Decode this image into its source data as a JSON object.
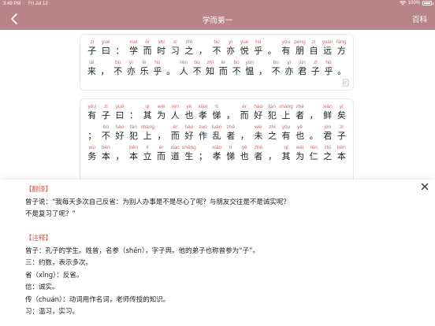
{
  "status": {
    "time": "3:49 PM",
    "date": "Fri Jul 12",
    "battery": "100%"
  },
  "nav": {
    "title": "学而第一",
    "right_label": "百科"
  },
  "passage1": [
    [
      {
        "py": "zǐ",
        "hz": "子"
      },
      {
        "py": "yuē",
        "hz": "曰"
      },
      {
        "py": "",
        "hz": "："
      },
      {
        "py": "xué",
        "hz": "学"
      },
      {
        "py": "ér",
        "hz": "而"
      },
      {
        "py": "shí",
        "hz": "时"
      },
      {
        "py": "xí",
        "hz": "习"
      },
      {
        "py": "zhī",
        "hz": "之"
      },
      {
        "py": "",
        "hz": "，"
      },
      {
        "py": "bù",
        "hz": "不"
      },
      {
        "py": "yì",
        "hz": "亦"
      },
      {
        "py": "yuè",
        "hz": "悦"
      },
      {
        "py": "hū",
        "hz": "乎"
      },
      {
        "py": "",
        "hz": "。"
      },
      {
        "py": "yǒu",
        "hz": "有"
      },
      {
        "py": "péng",
        "hz": "朋"
      },
      {
        "py": "zì",
        "hz": "自"
      },
      {
        "py": "yuǎn",
        "hz": "远"
      },
      {
        "py": "fāng",
        "hz": "方"
      }
    ],
    [
      {
        "py": "lái",
        "hz": "来"
      },
      {
        "py": "",
        "hz": "，"
      },
      {
        "py": "bú",
        "hz": "不"
      },
      {
        "py": "yì",
        "hz": "亦"
      },
      {
        "py": "lè",
        "hz": "乐"
      },
      {
        "py": "hū",
        "hz": "乎"
      },
      {
        "py": "",
        "hz": "。"
      },
      {
        "py": "rén",
        "hz": "人"
      },
      {
        "py": "bù",
        "hz": "不"
      },
      {
        "py": "zhī",
        "hz": "知"
      },
      {
        "py": "ér",
        "hz": "而"
      },
      {
        "py": "bú",
        "hz": "不"
      },
      {
        "py": "yùn",
        "hz": "愠"
      },
      {
        "py": "",
        "hz": "，"
      },
      {
        "py": "bú",
        "hz": "不"
      },
      {
        "py": "yì",
        "hz": "亦"
      },
      {
        "py": "jūn",
        "hz": "君"
      },
      {
        "py": "zǐ",
        "hz": "子"
      },
      {
        "py": "hū",
        "hz": "乎"
      },
      {
        "py": "",
        "hz": "。"
      }
    ]
  ],
  "passage2": [
    [
      {
        "py": "yǒu",
        "hz": "有"
      },
      {
        "py": "zǐ",
        "hz": "子"
      },
      {
        "py": "yuē",
        "hz": "曰"
      },
      {
        "py": "",
        "hz": "："
      },
      {
        "py": "qí",
        "hz": "其"
      },
      {
        "py": "wéi",
        "hz": "为"
      },
      {
        "py": "rén",
        "hz": "人"
      },
      {
        "py": "yě",
        "hz": "也"
      },
      {
        "py": "xiào",
        "hz": "孝"
      },
      {
        "py": "tì",
        "hz": "悌"
      },
      {
        "py": "",
        "hz": "，"
      },
      {
        "py": "ér",
        "hz": "而"
      },
      {
        "py": "hào",
        "hz": "好"
      },
      {
        "py": "fàn",
        "hz": "犯"
      },
      {
        "py": "shàng",
        "hz": "上"
      },
      {
        "py": "zhě",
        "hz": "者"
      },
      {
        "py": "",
        "hz": "，"
      },
      {
        "py": "xiǎn",
        "hz": "鲜"
      },
      {
        "py": "yǐ",
        "hz": "矣"
      }
    ],
    [
      {
        "py": "",
        "hz": "；"
      },
      {
        "py": "bù",
        "hz": "不"
      },
      {
        "py": "hào",
        "hz": "好"
      },
      {
        "py": "fàn",
        "hz": "犯"
      },
      {
        "py": "shàng",
        "hz": "上"
      },
      {
        "py": "",
        "hz": "，"
      },
      {
        "py": "ér",
        "hz": "而"
      },
      {
        "py": "hào",
        "hz": "好"
      },
      {
        "py": "zuò",
        "hz": "作"
      },
      {
        "py": "luàn",
        "hz": "乱"
      },
      {
        "py": "zhě",
        "hz": "者"
      },
      {
        "py": "",
        "hz": "，"
      },
      {
        "py": "wèi",
        "hz": "未"
      },
      {
        "py": "zhī",
        "hz": "之"
      },
      {
        "py": "yǒu",
        "hz": "有"
      },
      {
        "py": "yě",
        "hz": "也"
      },
      {
        "py": "",
        "hz": "。"
      },
      {
        "py": "jūn",
        "hz": "君"
      },
      {
        "py": "zǐ",
        "hz": "子"
      }
    ],
    [
      {
        "py": "wù",
        "hz": "务"
      },
      {
        "py": "běn",
        "hz": "本"
      },
      {
        "py": "",
        "hz": "，"
      },
      {
        "py": "běn",
        "hz": "本"
      },
      {
        "py": "lì",
        "hz": "立"
      },
      {
        "py": "ér",
        "hz": "而"
      },
      {
        "py": "dào",
        "hz": "道"
      },
      {
        "py": "shēng",
        "hz": "生"
      },
      {
        "py": "",
        "hz": "；"
      },
      {
        "py": "xiào",
        "hz": "孝"
      },
      {
        "py": "tì",
        "hz": "悌"
      },
      {
        "py": "yě",
        "hz": "也"
      },
      {
        "py": "zhě",
        "hz": "者"
      },
      {
        "py": "",
        "hz": "，"
      },
      {
        "py": "qí",
        "hz": "其"
      },
      {
        "py": "wéi",
        "hz": "为"
      },
      {
        "py": "rén",
        "hz": "仁"
      },
      {
        "py": "zhī",
        "hz": "之"
      },
      {
        "py": "běn",
        "hz": "本"
      }
    ]
  ],
  "sheet": {
    "translation_tag": "【翻译】",
    "translation_lines": [
      "曾子说：“我每天多次自己反省：为别人办事是不是尽心了呢？与朋友交往是不是诚实呢？",
      "不是复习了呢？”"
    ],
    "notes_tag": "【注释】",
    "notes_lines": [
      "曾子：孔子的学生。姓曾，名参（shēn），字子舆。他的弟子也称曾参为“子”。",
      "三：约数，表示多次。",
      "省（xǐng）：反省。",
      "信：诚实。",
      "传（chuán）：动词用作名词，老师传授的知识。",
      "习：温习，实习。"
    ]
  }
}
